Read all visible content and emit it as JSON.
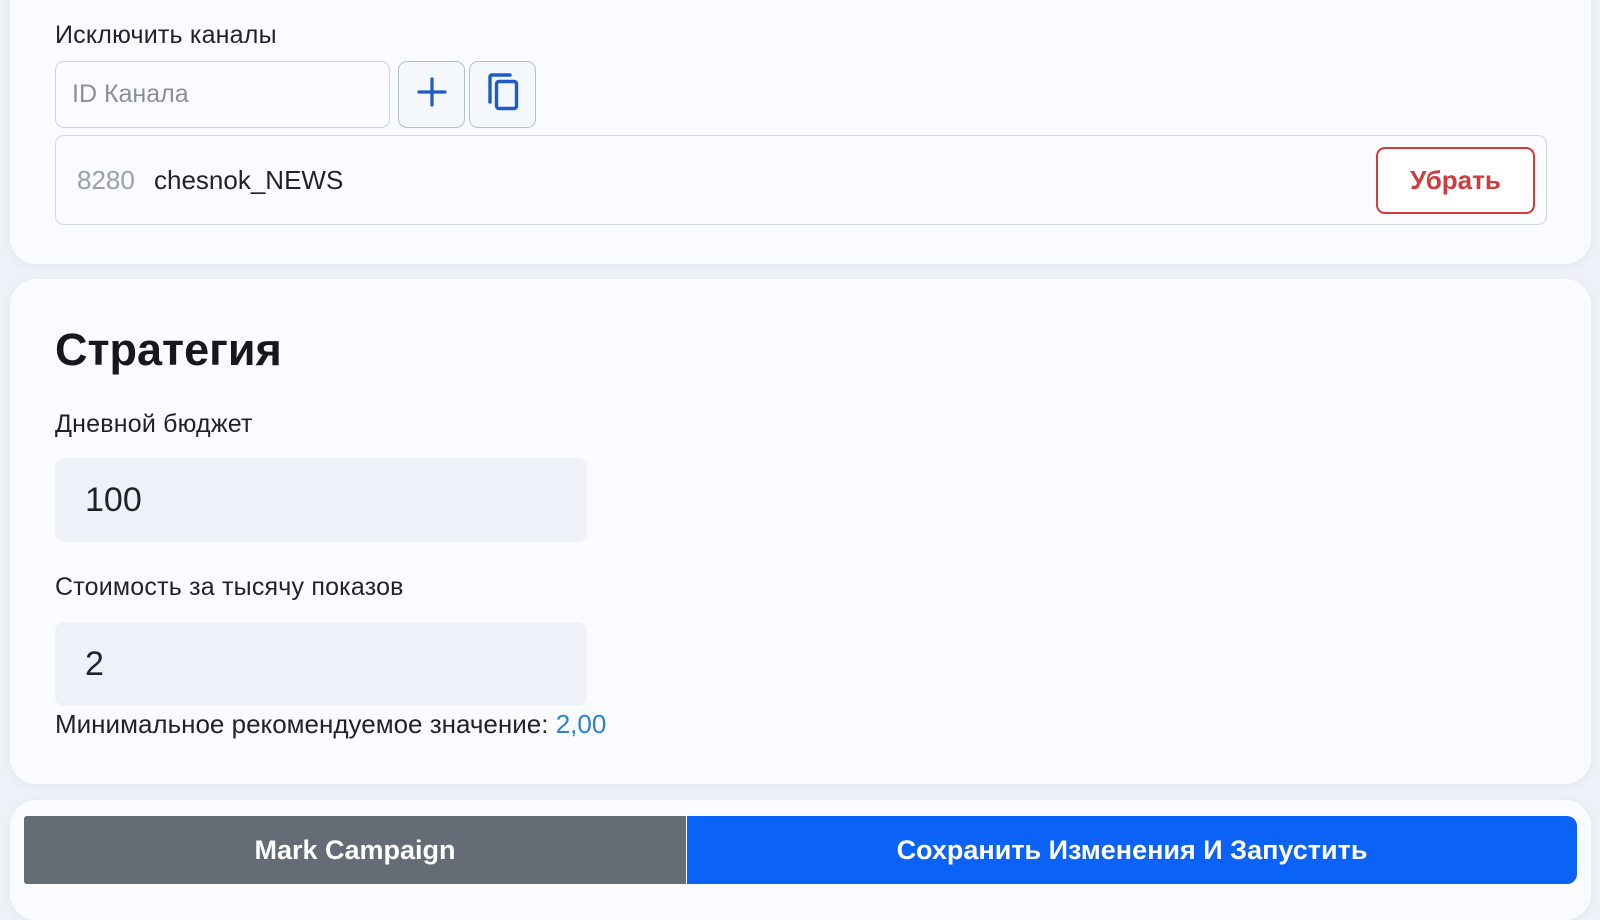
{
  "exclude_channels": {
    "label": "Исключить каналы",
    "input_placeholder": "ID Канала",
    "channels": [
      {
        "id": "8280",
        "name": "chesnok_NEWS",
        "remove_label": "Убрать"
      }
    ]
  },
  "strategy": {
    "title": "Стратегия",
    "daily_budget": {
      "label": "Дневной бюджет",
      "value": "100"
    },
    "cpm": {
      "label": "Стоимость за тысячу показов",
      "value": "2"
    },
    "hint": {
      "text": "Минимальное рекомендуемое значение:",
      "value": "2,00"
    }
  },
  "actions": {
    "mark_label": "Mark Campaign",
    "save_label": "Сохранить Изменения И Запустить"
  },
  "icons": {
    "add": "plus-icon",
    "paste": "copy-icon"
  },
  "colors": {
    "accent": "#0b62f6",
    "danger": "#d23b3b",
    "secondary": "#656c75",
    "link": "#2f7fd8"
  }
}
